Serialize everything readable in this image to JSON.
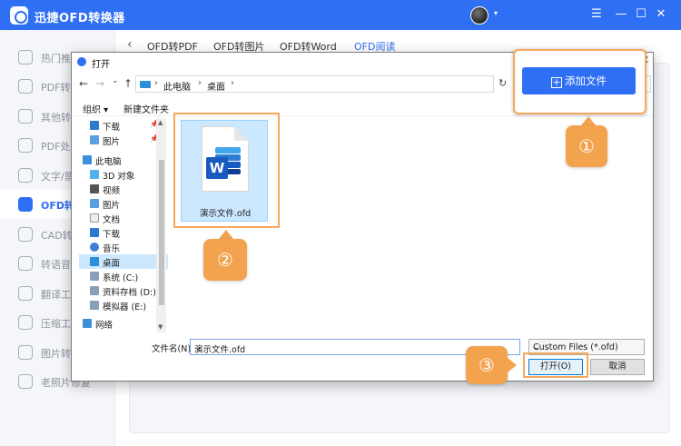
{
  "app": {
    "title": "迅捷OFD转换器",
    "window_controls": [
      "☰",
      "—",
      "☐",
      "✕"
    ],
    "accent_color": "#2f6ff3"
  },
  "sidebar": {
    "items": [
      {
        "label": "热门推荐",
        "icon": "fire-icon",
        "active": false
      },
      {
        "label": "PDF转换",
        "icon": "pdf-icon",
        "active": false
      },
      {
        "label": "其他转换",
        "icon": "convert-icon",
        "active": false
      },
      {
        "label": "PDF处理",
        "icon": "pdf-tool-icon",
        "active": false
      },
      {
        "label": "文字/票据识别",
        "icon": "ocr-icon",
        "active": false
      },
      {
        "label": "OFD转换",
        "icon": "ofd-icon",
        "active": true
      },
      {
        "label": "CAD转换",
        "icon": "cad-icon",
        "active": false
      },
      {
        "label": "转语音工具",
        "icon": "voice-icon",
        "active": false
      },
      {
        "label": "翻译工具",
        "icon": "translate-icon",
        "active": false
      },
      {
        "label": "压缩工具",
        "icon": "compress-icon",
        "active": false
      },
      {
        "label": "图片转换",
        "icon": "image-icon",
        "active": false
      },
      {
        "label": "老照片修复",
        "icon": "photo-repair-icon",
        "active": false
      }
    ]
  },
  "main": {
    "back": "‹",
    "tabs": [
      {
        "label": "OFD转PDF",
        "active": false
      },
      {
        "label": "OFD转图片",
        "active": false
      },
      {
        "label": "OFD转Word",
        "active": false
      },
      {
        "label": "OFD阅读",
        "active": true
      }
    ]
  },
  "callout": {
    "add_file_label": "添加文件",
    "plus": "+",
    "steps": [
      "①",
      "②",
      "③"
    ],
    "annotation_color": "#f3a24e"
  },
  "dialog": {
    "title": "打开",
    "close": "✕",
    "nav": {
      "back": "←",
      "forward": "→",
      "dropdown": "⌄",
      "up": "↑",
      "refresh": "↻"
    },
    "address": [
      "此电脑",
      "桌面"
    ],
    "address_sep": "›",
    "toolbar": {
      "organize": "组织 ▾",
      "new_folder": "新建文件夹"
    },
    "tree": [
      {
        "label": "下载",
        "icon": "download-icon",
        "pinned": true
      },
      {
        "label": "图片",
        "icon": "pictures-icon",
        "pinned": true
      },
      {
        "label": "此电脑",
        "icon": "computer-icon",
        "pinned": false
      },
      {
        "label": "3D 对象",
        "icon": "3d-objects-icon",
        "pinned": false
      },
      {
        "label": "视频",
        "icon": "video-icon",
        "pinned": false
      },
      {
        "label": "图片",
        "icon": "pictures-icon",
        "pinned": false
      },
      {
        "label": "文档",
        "icon": "documents-icon",
        "pinned": false
      },
      {
        "label": "下载",
        "icon": "download-icon",
        "pinned": false
      },
      {
        "label": "音乐",
        "icon": "music-icon",
        "pinned": false
      },
      {
        "label": "桌面",
        "icon": "desktop-icon",
        "pinned": false,
        "selected": true
      },
      {
        "label": "系统 (C:)",
        "icon": "drive-icon",
        "pinned": false
      },
      {
        "label": "资料存档 (D:)",
        "icon": "drive-icon",
        "pinned": false
      },
      {
        "label": "模拟器 (E:)",
        "icon": "drive-icon",
        "pinned": false
      },
      {
        "label": "网络",
        "icon": "network-icon",
        "pinned": false
      }
    ],
    "pin_glyph": "📌",
    "file": {
      "name": "演示文件.ofd",
      "badge": "W"
    },
    "filename_label": "文件名(N):",
    "filename_value": "演示文件.ofd",
    "filetype_value": "Custom Files (*.ofd)",
    "open_label": "打开(O)",
    "cancel_label": "取消",
    "caret": "⌄"
  }
}
